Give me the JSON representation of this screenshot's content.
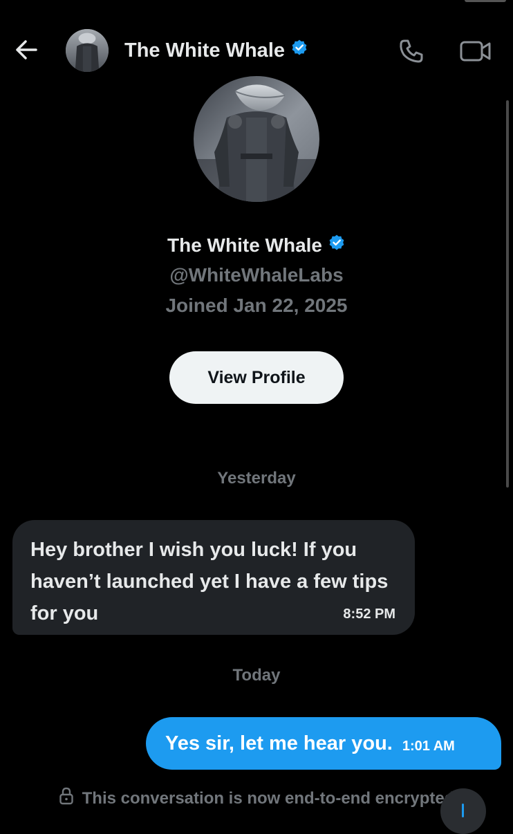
{
  "header": {
    "title": "The White Whale",
    "back_icon": "arrow-left-icon",
    "call_icon": "phone-icon",
    "video_icon": "video-camera-icon"
  },
  "profile": {
    "name": "The White Whale",
    "handle": "@WhiteWhaleLabs",
    "joined": "Joined Jan 22, 2025",
    "view_profile_label": "View Profile"
  },
  "messages": [
    {
      "day": "Yesterday",
      "direction": "incoming",
      "text": "Hey brother I wish you luck! If you haven’t launched yet I have a few tips for you",
      "time": "8:52 PM"
    },
    {
      "day": "Today",
      "direction": "outgoing",
      "text": "Yes sir, let me hear you.",
      "time": "1:01 AM"
    }
  ],
  "footer": {
    "encrypted_note": "This conversation is now end-to-end encrypted"
  },
  "colors": {
    "background": "#000000",
    "accent": "#1d9bf0",
    "incoming_bubble": "#202327",
    "secondary_text": "#71767b"
  }
}
